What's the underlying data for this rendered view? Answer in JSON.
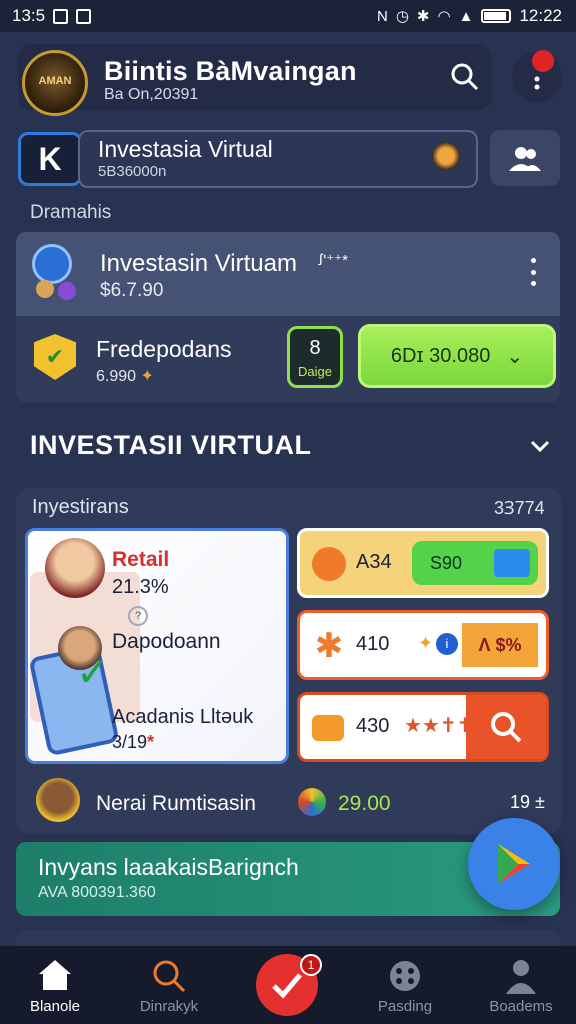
{
  "status_bar": {
    "left_time": "13:5",
    "right_time": "12:22"
  },
  "header": {
    "title": "Biintis BàMvaingan",
    "subtitle": "Ba On,20391",
    "logo_icon": "crest-logo-icon"
  },
  "invest_bar": {
    "title": "Investasia Virtual",
    "sub": "5B36000n"
  },
  "section_label": "Dramahis",
  "card_main": {
    "title": "Investasin Virtuam",
    "stars": "ꭍ'⁺⁺*",
    "amount": "$6.7.90"
  },
  "promo_row": {
    "title": "Fredepodans",
    "sub": "6.990",
    "badge_num": "8",
    "badge_sub": "Daige",
    "button": "6Dɪ 30.080"
  },
  "big_section": {
    "title": "INVESTASII VIRTUAL"
  },
  "panel": {
    "label": "Inyestirans",
    "count": "3Ɜ774"
  },
  "retail": {
    "title": "Retail",
    "pct": "21.3%",
    "name": "Dapodoann",
    "name2": "Acadanis Lltəuk",
    "num": "3/19",
    "num_mark": "*"
  },
  "right_cards": [
    {
      "value": "A34",
      "pill": "S90"
    },
    {
      "value": "410",
      "right": "Λ $%"
    },
    {
      "value": "430",
      "stars": "★★✝✝"
    }
  ],
  "review": {
    "name": "Nerai Rumtisasin",
    "value": "29.00",
    "right": "19 ±"
  },
  "promo": {
    "title": "Invyans laaakaisBarignch",
    "sub": "AVA 800391.360"
  },
  "nav": [
    {
      "label": "Blanole",
      "active": true
    },
    {
      "label": "Dinrakyk",
      "active": false
    },
    {
      "label": "",
      "active": false
    },
    {
      "label": "Pasding",
      "active": false
    },
    {
      "label": "Boadems",
      "active": false
    }
  ],
  "fab_badge": "1",
  "colors": {
    "accent_green": "#8fe04a",
    "accent_blue": "#3a82e8",
    "danger": "#e53030",
    "background": "#283251"
  }
}
